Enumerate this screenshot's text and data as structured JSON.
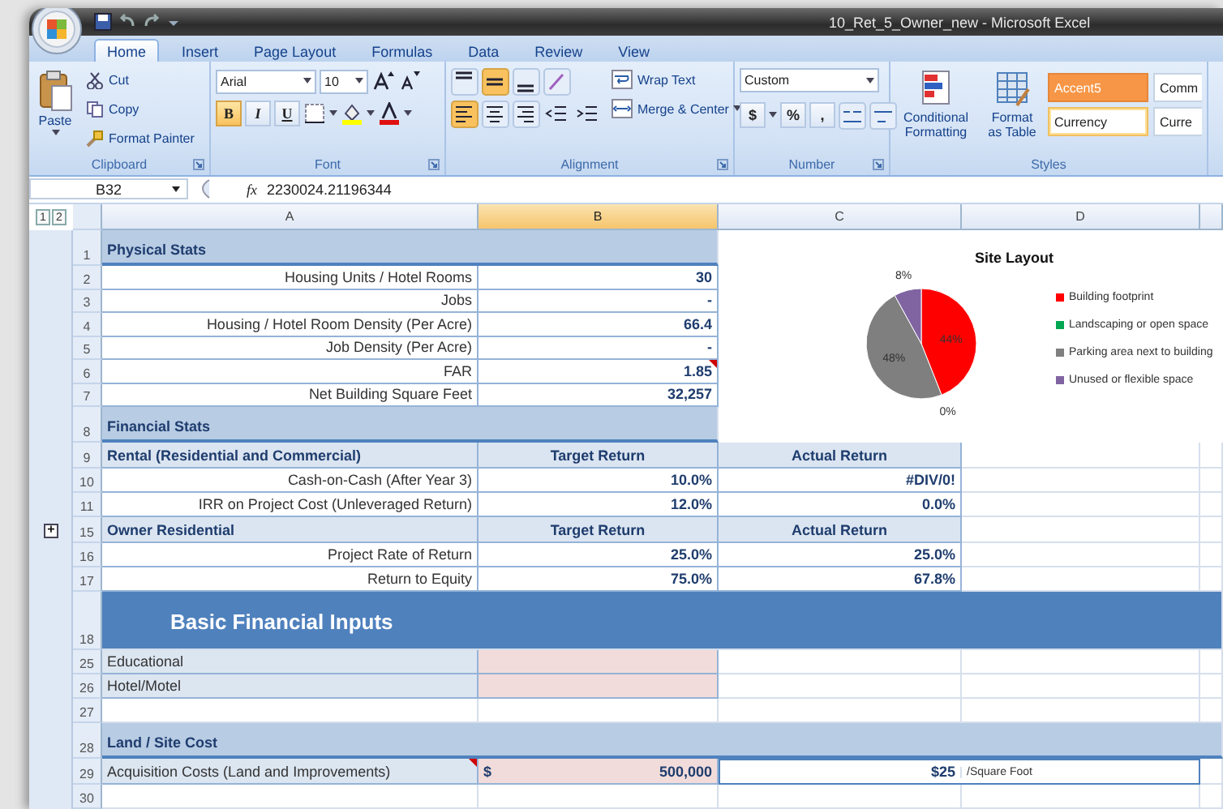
{
  "window": {
    "title": "10_Ret_5_Owner_new - Microsoft Excel"
  },
  "ribbon_tabs": [
    {
      "label": "Home",
      "selected": true
    },
    {
      "label": "Insert",
      "selected": false
    },
    {
      "label": "Page Layout",
      "selected": false
    },
    {
      "label": "Formulas",
      "selected": false
    },
    {
      "label": "Data",
      "selected": false
    },
    {
      "label": "Review",
      "selected": false
    },
    {
      "label": "View",
      "selected": false
    }
  ],
  "ribbon": {
    "clipboard": {
      "label": "Clipboard",
      "paste": "Paste",
      "cut": "Cut",
      "copy": "Copy",
      "format_painter": "Format Painter"
    },
    "font": {
      "label": "Font",
      "font_name": "Arial",
      "font_size": "10",
      "style_buttons": [
        {
          "label": "B",
          "selected": true
        },
        {
          "label": "I",
          "selected": false
        },
        {
          "label": "U",
          "selected": false
        }
      ]
    },
    "alignment": {
      "label": "Alignment",
      "vertical": [
        {
          "selected": false
        },
        {
          "selected": true
        },
        {
          "selected": false
        }
      ],
      "horizontal": [
        {
          "selected": true
        },
        {
          "selected": false
        },
        {
          "selected": false
        }
      ],
      "wrap_text": "Wrap Text",
      "merge": "Merge & Center"
    },
    "number": {
      "label": "Number",
      "format": "Custom",
      "buttons": [
        "$",
        "%",
        ","
      ]
    },
    "styles": {
      "label": "Styles",
      "conditional": "Conditional Formatting",
      "format_table": "Format as Table",
      "cell_styles": [
        {
          "label": "Accent5",
          "kind": "accent"
        },
        {
          "label": "Comm",
          "kind": "plain"
        },
        {
          "label": "Currency",
          "kind": "outlined"
        },
        {
          "label": "Curre",
          "kind": "plain"
        }
      ]
    }
  },
  "formula_bar": {
    "name_box": "B32",
    "fx": "fx",
    "value": "2230024.21196344"
  },
  "sheet": {
    "outline_levels": [
      "1",
      "2"
    ],
    "columns": [
      {
        "label": "A",
        "selected": false
      },
      {
        "label": "B",
        "selected": true
      },
      {
        "label": "C",
        "selected": false
      },
      {
        "label": "D",
        "selected": false
      }
    ],
    "rows": [
      {
        "number": "1",
        "kind": "section",
        "full_width": false,
        "label": "Physical Stats"
      },
      {
        "number": "2",
        "kind": "data",
        "label": "Housing Units / Hotel Rooms",
        "value": "30",
        "comment": false
      },
      {
        "number": "3",
        "kind": "data",
        "label": "Jobs",
        "value": "-",
        "comment": false
      },
      {
        "number": "4",
        "kind": "data",
        "label": "Housing / Hotel Room Density (Per Acre)",
        "value": "66.4",
        "comment": false
      },
      {
        "number": "5",
        "kind": "data",
        "label": "Job Density (Per Acre)",
        "value": "-",
        "comment": false
      },
      {
        "number": "6",
        "kind": "data",
        "label": "FAR",
        "value": "1.85",
        "comment": true
      },
      {
        "number": "7",
        "kind": "data",
        "label": "Net Building Square Feet",
        "value": "32,257",
        "comment": false
      },
      {
        "number": "8",
        "kind": "section",
        "full_width": false,
        "label": "Financial Stats"
      },
      {
        "number": "9",
        "kind": "subheader",
        "label": "Rental (Residential and Commercial)",
        "target": "Target Return",
        "actual": "Actual Return"
      },
      {
        "number": "10",
        "kind": "return",
        "label": "Cash-on-Cash (After Year 3)",
        "target": "10.0%",
        "actual": "#DIV/0!"
      },
      {
        "number": "11",
        "kind": "return",
        "label": "IRR on Project Cost (Unleveraged Return)",
        "target": "12.0%",
        "actual": "0.0%"
      },
      {
        "number": "15",
        "kind": "subheader",
        "label": "Owner Residential",
        "target": "Target Return",
        "actual": "Actual Return",
        "outline_button": "+"
      },
      {
        "number": "16",
        "kind": "return",
        "label": "Project Rate of Return",
        "target": "25.0%",
        "actual": "25.0%"
      },
      {
        "number": "17",
        "kind": "return",
        "label": "Return to Equity",
        "target": "75.0%",
        "actual": "67.8%"
      },
      {
        "number": "18",
        "kind": "banner",
        "label": "Basic Financial Inputs"
      },
      {
        "number": "25",
        "kind": "input",
        "label": "Educational"
      },
      {
        "number": "26",
        "kind": "input",
        "label": "Hotel/Motel"
      },
      {
        "number": "27",
        "kind": "blank"
      },
      {
        "number": "28",
        "kind": "section",
        "full_width": true,
        "label": "Land / Site Cost"
      },
      {
        "number": "29",
        "kind": "cost",
        "label": "Acquisition Costs (Land and Improvements)",
        "currency": "$",
        "value": "500,000",
        "per_unit": "$25",
        "unit": "/Square Foot",
        "comment": true
      },
      {
        "number": "30",
        "kind": "blank"
      }
    ],
    "chart": {
      "chart_data": {
        "type": "pie",
        "title": "Site Layout",
        "categories": [
          "Building footprint",
          "Landscaping or open space",
          "Parking area next to building",
          "Unused or flexible space"
        ],
        "values": [
          44,
          0,
          48,
          8
        ],
        "value_labels": [
          "44%",
          "0%",
          "48%",
          "8%"
        ],
        "legend": "right"
      },
      "slices": [
        {
          "color": "#ff0000"
        },
        {
          "color": "#00a651"
        },
        {
          "color": "#7f7f7f"
        },
        {
          "color": "#8064a2"
        }
      ]
    }
  }
}
